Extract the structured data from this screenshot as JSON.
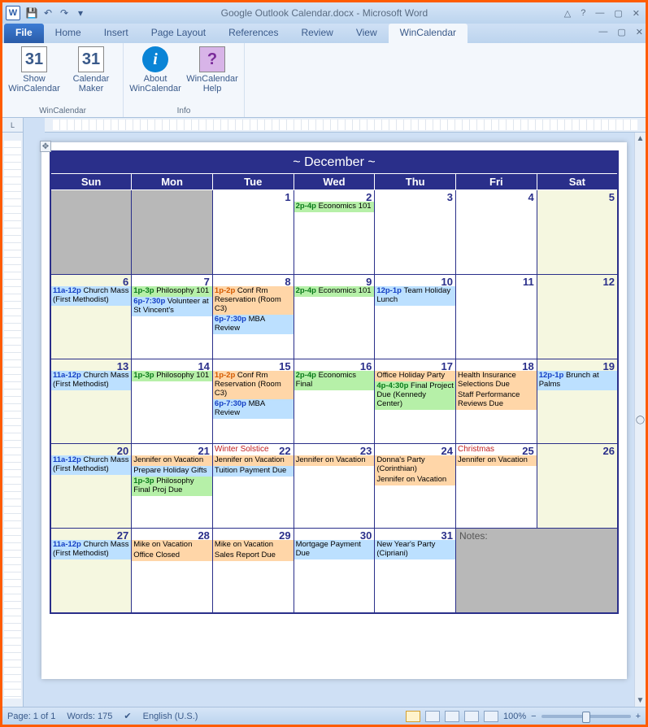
{
  "window": {
    "title": "Google Outlook Calendar.docx  -  Microsoft Word"
  },
  "qat": {
    "save": "💾",
    "undo": "↶",
    "redo": "↷",
    "extra": "ᵃ"
  },
  "tabs": [
    "File",
    "Home",
    "Insert",
    "Page Layout",
    "References",
    "Review",
    "View",
    "WinCalendar"
  ],
  "ribbon": {
    "group1": {
      "label": "WinCalendar",
      "btns": [
        {
          "label": "Show WinCalendar",
          "icon": "31"
        },
        {
          "label": "Calendar Maker",
          "icon": "31"
        }
      ]
    },
    "group2": {
      "label": "Info",
      "btns": [
        {
          "label": "About WinCalendar",
          "icon": "i"
        },
        {
          "label": "WinCalendar Help",
          "icon": "?"
        }
      ]
    }
  },
  "cal": {
    "title": "~ December ~",
    "days": [
      "Sun",
      "Mon",
      "Tue",
      "Wed",
      "Thu",
      "Fri",
      "Sat"
    ],
    "weeks": [
      [
        {
          "blank": true
        },
        {
          "blank": true
        },
        {
          "n": "1"
        },
        {
          "n": "2",
          "ev": [
            {
              "c": "green",
              "tm": "2p-4p",
              "t": "Economics 101"
            }
          ]
        },
        {
          "n": "3"
        },
        {
          "n": "4"
        },
        {
          "n": "5",
          "soft": true
        }
      ],
      [
        {
          "n": "6",
          "soft": true,
          "ev": [
            {
              "c": "blue",
              "tm": "11a-12p",
              "t": "Church Mass (First Methodist)"
            }
          ]
        },
        {
          "n": "7",
          "ev": [
            {
              "c": "green",
              "tm": "1p-3p",
              "t": "Philosophy 101"
            },
            {
              "c": "blue",
              "tm": "6p-7:30p",
              "t": "Volunteer at St Vincent's"
            }
          ]
        },
        {
          "n": "8",
          "ev": [
            {
              "c": "orange",
              "tm": "1p-2p",
              "t": "Conf Rm Reservation (Room C3)"
            },
            {
              "c": "blue",
              "tm": "6p-7:30p",
              "t": "MBA Review"
            }
          ]
        },
        {
          "n": "9",
          "ev": [
            {
              "c": "green",
              "tm": "2p-4p",
              "t": "Economics 101"
            }
          ]
        },
        {
          "n": "10",
          "ev": [
            {
              "c": "blue",
              "tm": "12p-1p",
              "t": "Team Holiday Lunch"
            }
          ]
        },
        {
          "n": "11"
        },
        {
          "n": "12",
          "soft": true
        }
      ],
      [
        {
          "n": "13",
          "soft": true,
          "ev": [
            {
              "c": "blue",
              "tm": "11a-12p",
              "t": "Church Mass (First Methodist)"
            }
          ]
        },
        {
          "n": "14",
          "ev": [
            {
              "c": "green",
              "tm": "1p-3p",
              "t": "Philosophy 101"
            }
          ]
        },
        {
          "n": "15",
          "ev": [
            {
              "c": "orange",
              "tm": "1p-2p",
              "t": "Conf Rm Reservation (Room C3)"
            },
            {
              "c": "blue",
              "tm": "6p-7:30p",
              "t": "MBA Review"
            }
          ]
        },
        {
          "n": "16",
          "ev": [
            {
              "c": "green",
              "tm": "2p-4p",
              "t": "Economics Final"
            }
          ]
        },
        {
          "n": "17",
          "ev": [
            {
              "c": "orange",
              "tm": "",
              "t": "Office Holiday Party"
            },
            {
              "c": "green",
              "tm": "4p-4:30p",
              "t": "Final Project Due (Kennedy Center)"
            }
          ]
        },
        {
          "n": "18",
          "ev": [
            {
              "c": "orange",
              "tm": "",
              "t": "Health Insurance Selections Due"
            },
            {
              "c": "orange",
              "tm": "",
              "t": "Staff Performance Reviews Due"
            }
          ]
        },
        {
          "n": "19",
          "soft": true,
          "ev": [
            {
              "c": "blue",
              "tm": "12p-1p",
              "t": "Brunch at Palms"
            }
          ]
        }
      ],
      [
        {
          "n": "20",
          "soft": true,
          "ev": [
            {
              "c": "blue",
              "tm": "11a-12p",
              "t": "Church Mass (First Methodist)"
            }
          ]
        },
        {
          "n": "21",
          "ev": [
            {
              "c": "orange",
              "tm": "",
              "t": "Jennifer on Vacation"
            },
            {
              "c": "blue",
              "tm": "",
              "t": "Prepare Holiday Gifts"
            },
            {
              "c": "green",
              "tm": "1p-3p",
              "t": "Philosophy Final Proj Due"
            }
          ]
        },
        {
          "n": "22",
          "hol": "Winter Solstice",
          "ev": [
            {
              "c": "orange",
              "tm": "",
              "t": "Jennifer on Vacation"
            },
            {
              "c": "blue",
              "tm": "",
              "t": "Tuition Payment Due"
            }
          ]
        },
        {
          "n": "23",
          "ev": [
            {
              "c": "orange",
              "tm": "",
              "t": "Jennifer on Vacation"
            }
          ]
        },
        {
          "n": "24",
          "ev": [
            {
              "c": "orange",
              "tm": "",
              "t": "Donna's Party (Corinthian)"
            },
            {
              "c": "orange",
              "tm": "",
              "t": "Jennifer on Vacation"
            }
          ]
        },
        {
          "n": "25",
          "hol": "Christmas",
          "ev": [
            {
              "c": "orange",
              "tm": "",
              "t": "Jennifer on Vacation"
            }
          ]
        },
        {
          "n": "26",
          "soft": true
        }
      ],
      [
        {
          "n": "27",
          "soft": true,
          "ev": [
            {
              "c": "blue",
              "tm": "11a-12p",
              "t": "Church Mass (First Methodist)"
            }
          ]
        },
        {
          "n": "28",
          "ev": [
            {
              "c": "orange",
              "tm": "",
              "t": "Mike on Vacation"
            },
            {
              "c": "orange",
              "tm": "",
              "t": "Office Closed"
            }
          ]
        },
        {
          "n": "29",
          "ev": [
            {
              "c": "orange",
              "tm": "",
              "t": "Mike on Vacation"
            },
            {
              "c": "orange",
              "tm": "",
              "t": "Sales Report Due"
            }
          ]
        },
        {
          "n": "30",
          "ev": [
            {
              "c": "blue",
              "tm": "",
              "t": "Mortgage Payment Due"
            }
          ]
        },
        {
          "n": "31",
          "ev": [
            {
              "c": "blue",
              "tm": "",
              "t": "New Year's Party (Cipriani)"
            }
          ]
        },
        {
          "notes": true,
          "label": "Notes:",
          "span": 2
        }
      ]
    ]
  },
  "status": {
    "page": "Page: 1 of 1",
    "words": "Words: 175",
    "lang": "English (U.S.)",
    "zoom": "100%"
  }
}
